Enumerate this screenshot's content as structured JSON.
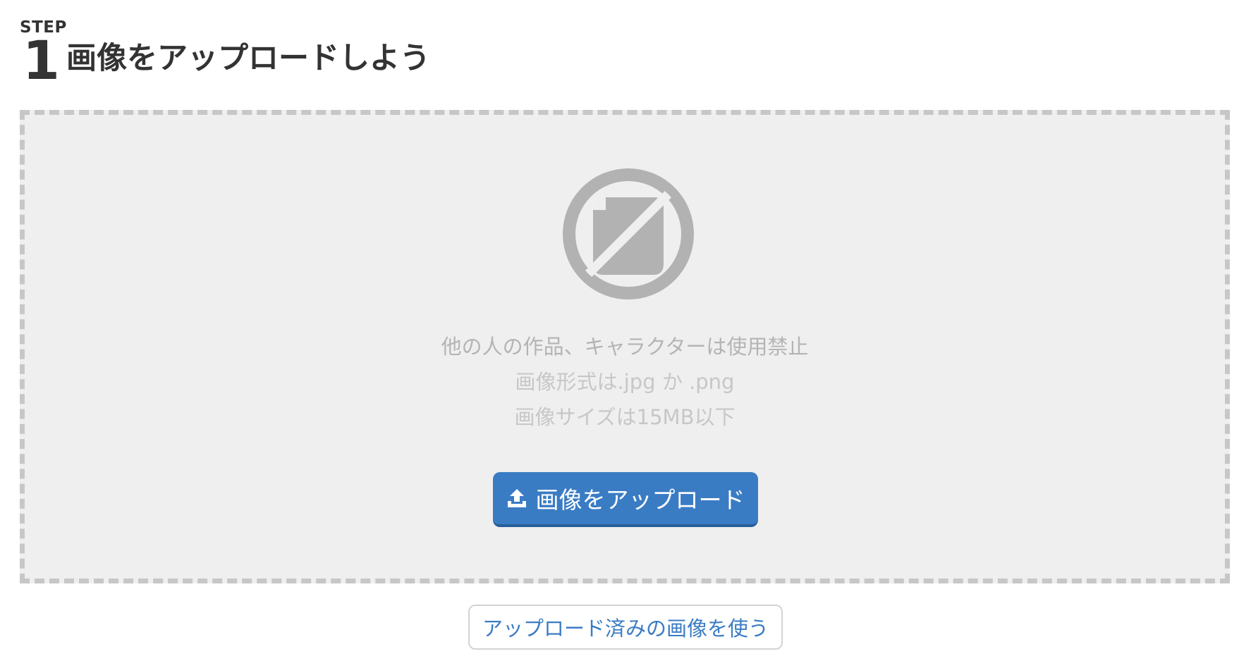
{
  "header": {
    "step_label": "STEP",
    "step_number": "1",
    "title": "画像をアップロードしよう"
  },
  "drop_zone": {
    "icon": "no-image-icon",
    "notes": {
      "warning": "他の人の作品、キャラクターは使用禁止",
      "format": "画像形式は.jpg か .png",
      "size": "画像サイズは15MB以下"
    },
    "upload_button": {
      "label": "画像をアップロード",
      "icon": "upload-icon"
    }
  },
  "used_images_button": {
    "label": "アップロード済みの画像を使う"
  },
  "colors": {
    "accent": "#3a7cc4",
    "drop_zone_bg": "#efefef",
    "drop_zone_border": "#c7c7c7",
    "icon_gray": "#b2b2b2",
    "heading": "#333333"
  }
}
